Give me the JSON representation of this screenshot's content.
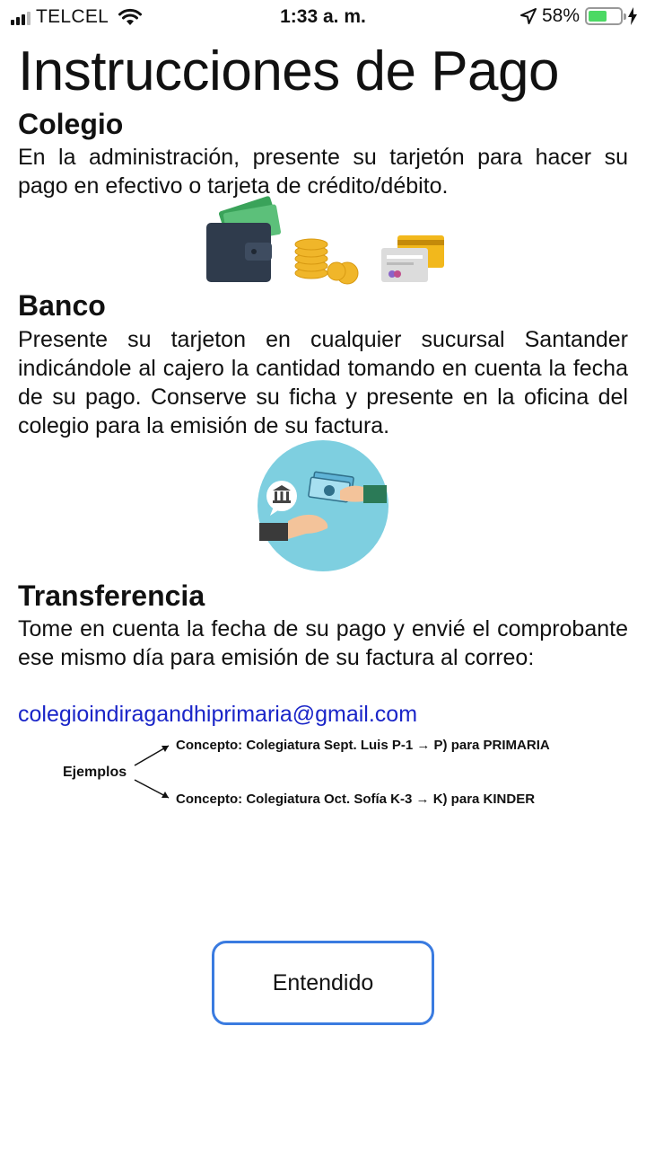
{
  "status_bar": {
    "carrier": "TELCEL",
    "time": "1:33 a. m.",
    "battery": "58%",
    "battery_level": 0.58
  },
  "page": {
    "title": "Instrucciones de Pago"
  },
  "sections": {
    "colegio": {
      "title": "Colegio",
      "text": "En la administración, presente su tarjetón para hacer su pago en efectivo o tarjeta de crédito/débito."
    },
    "banco": {
      "title": "Banco",
      "text": "Presente su tarjeton en cualquier sucursal Santander indicándole al cajero la cantidad tomando en cuenta la fecha de su pago. Conserve su ficha y presente en la oficina del colegio para la emisión de su factura."
    },
    "transferencia": {
      "title": "Transferencia",
      "text": "Tome en cuenta la fecha de su pago y envié el comprobante ese mismo día para emisión de su factura al correo:",
      "email": "colegioindiragandhiprimaria@gmail.com"
    }
  },
  "examples": {
    "label": "Ejemplos",
    "line1": "Concepto: Colegiatura Sept. Luis P-1 → P) para PRIMARIA",
    "line2": "Concepto: Colegiatura Oct. Sofía K-3 → K) para KINDER"
  },
  "button": {
    "label": "Entendido"
  },
  "colors": {
    "accent": "#3a7be0",
    "link": "#1a25c8",
    "battery_fill": "#4cd964",
    "bank_circle": "#7ecfe0"
  }
}
